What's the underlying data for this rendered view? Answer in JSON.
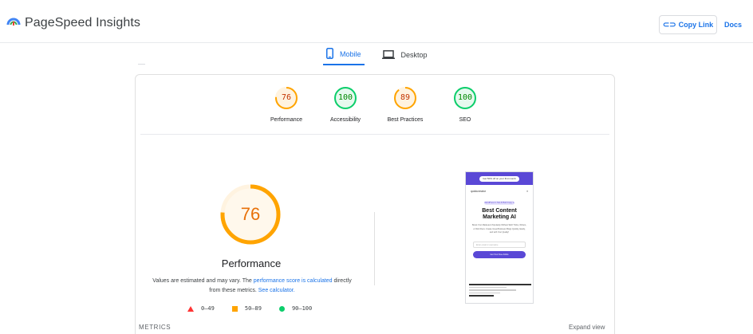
{
  "app": {
    "title": "PageSpeed Insights",
    "brand_colors": [
      "#4285f4",
      "#34a853",
      "#fbbc04",
      "#ea4335"
    ]
  },
  "header": {
    "copy_link_icon": "link-icon",
    "copy_link_label": "Copy Link",
    "docs_label": "Docs"
  },
  "tabs": [
    {
      "label": "Mobile",
      "icon": "smartphone-icon",
      "active": true
    },
    {
      "label": "Desktop",
      "icon": "laptop-icon",
      "active": false
    }
  ],
  "scores": [
    {
      "value": "76",
      "label": "Performance",
      "fraction": 0.76,
      "color": "#ffa400",
      "text_color": "#c33300"
    },
    {
      "value": "100",
      "label": "Accessibility",
      "fraction": 1.0,
      "color": "#0cce6b",
      "text_color": "#008800"
    },
    {
      "value": "89",
      "label": "Best Practices",
      "fraction": 0.89,
      "color": "#ffa400",
      "text_color": "#c33300"
    },
    {
      "value": "100",
      "label": "SEO",
      "fraction": 1.0,
      "color": "#0cce6b",
      "text_color": "#008800"
    }
  ],
  "performance": {
    "value": "76",
    "fraction": 0.76,
    "title": "Performance",
    "note_prefix": "Values are estimated and may vary. The ",
    "note_link1": "performance score is calculated",
    "note_middle": " directly from these metrics. ",
    "note_link2": "See calculator.",
    "legend": [
      {
        "shape": "triangle",
        "range": "0–49",
        "color": "#ff3333"
      },
      {
        "shape": "square",
        "range": "50–89",
        "color": "#ffa400"
      },
      {
        "shape": "circle",
        "range": "90–100",
        "color": "#0cce6b"
      }
    ]
  },
  "screenshot": {
    "promo": "Get 50% off on your first month",
    "logo": "quickcreator",
    "badge": "WordPress Is Not AI Built Copy is",
    "headline_1": "Best Content",
    "headline_2": "Marketing AI",
    "subtitle": "Boost Your Marketers Popularity Without SEO Tricks, Writers, or Web Devs. Create Great Business Blogs Quickly, Easily, and with Your Quality!",
    "input_placeholder": "Enter email or username",
    "cta": "Get Your Free Article"
  },
  "footer": {
    "metrics_label": "METRICS",
    "expand_label": "Expand view"
  }
}
